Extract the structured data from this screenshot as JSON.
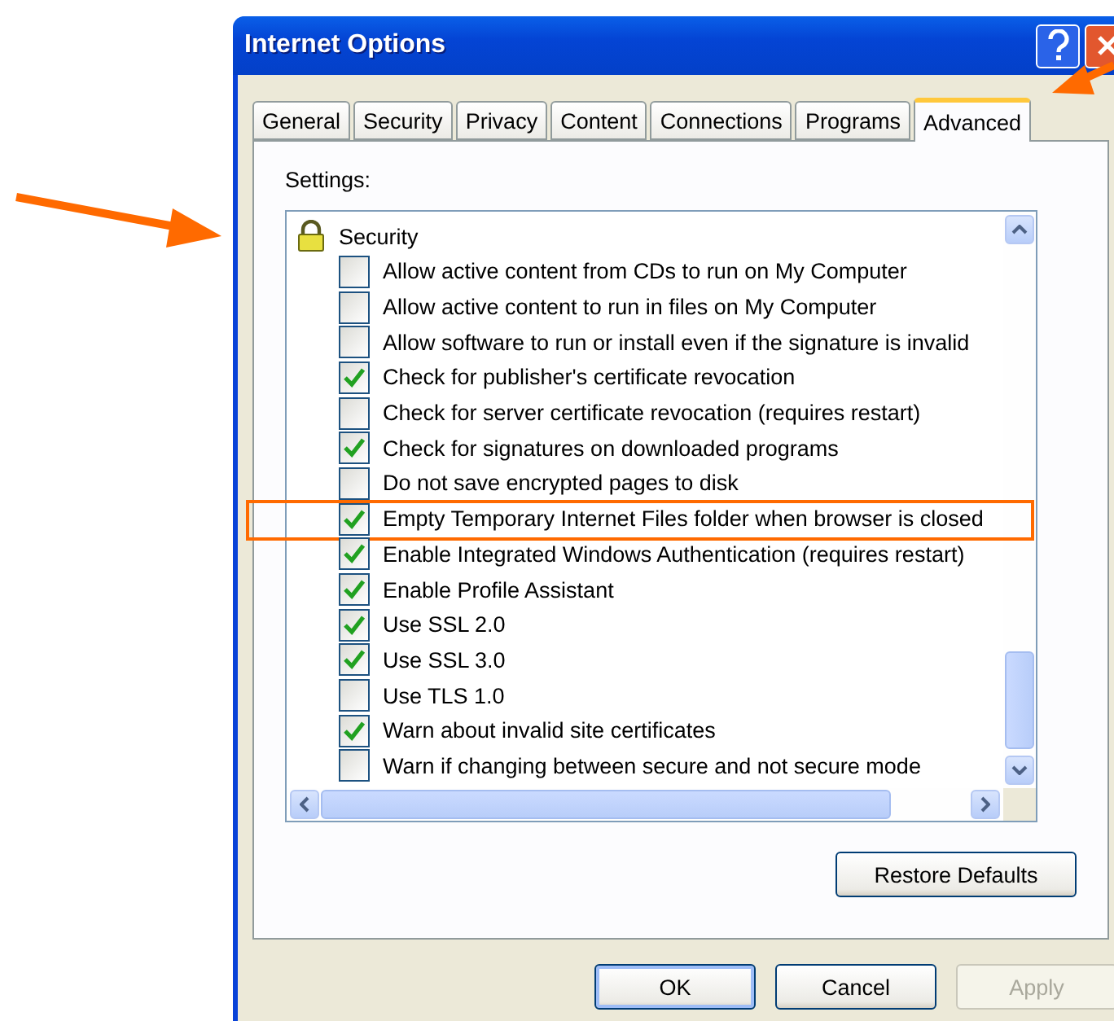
{
  "window": {
    "title": "Internet Options"
  },
  "tabs": [
    {
      "label": "General",
      "selected": false
    },
    {
      "label": "Security",
      "selected": false
    },
    {
      "label": "Privacy",
      "selected": false
    },
    {
      "label": "Content",
      "selected": false
    },
    {
      "label": "Connections",
      "selected": false
    },
    {
      "label": "Programs",
      "selected": false
    },
    {
      "label": "Advanced",
      "selected": true
    }
  ],
  "settings_label": "Settings:",
  "settings_tree": [
    {
      "label": "Security",
      "kind": "group",
      "children": [
        {
          "label": "Allow active content from CDs to run on My Computer",
          "checked": false,
          "highlighted": false
        },
        {
          "label": "Allow active content to run in files on My Computer",
          "checked": false,
          "highlighted": false
        },
        {
          "label": "Allow software to run or install even if the signature is invalid",
          "checked": false,
          "highlighted": false
        },
        {
          "label": "Check for publisher's certificate revocation",
          "checked": true,
          "highlighted": false
        },
        {
          "label": "Check for server certificate revocation (requires restart)",
          "checked": false,
          "highlighted": false
        },
        {
          "label": "Check for signatures on downloaded programs",
          "checked": true,
          "highlighted": false
        },
        {
          "label": "Do not save encrypted pages to disk",
          "checked": false,
          "highlighted": false
        },
        {
          "label": "Empty Temporary Internet Files folder when browser is closed",
          "checked": true,
          "highlighted": true
        },
        {
          "label": "Enable Integrated Windows Authentication (requires restart)",
          "checked": true,
          "highlighted": false
        },
        {
          "label": "Enable Profile Assistant",
          "checked": true,
          "highlighted": false
        },
        {
          "label": "Use SSL 2.0",
          "checked": true,
          "highlighted": false
        },
        {
          "label": "Use SSL 3.0",
          "checked": true,
          "highlighted": false
        },
        {
          "label": "Use TLS 1.0",
          "checked": false,
          "highlighted": false
        },
        {
          "label": "Warn about invalid site certificates",
          "checked": true,
          "highlighted": false
        },
        {
          "label": "Warn if changing between secure and not secure mode",
          "checked": false,
          "highlighted": false
        }
      ]
    }
  ],
  "restore_button": "Restore Defaults",
  "dialog_buttons": [
    {
      "label": "OK",
      "default": true,
      "disabled": false
    },
    {
      "label": "Cancel",
      "default": false,
      "disabled": false
    },
    {
      "label": "Apply",
      "default": false,
      "disabled": true
    }
  ]
}
